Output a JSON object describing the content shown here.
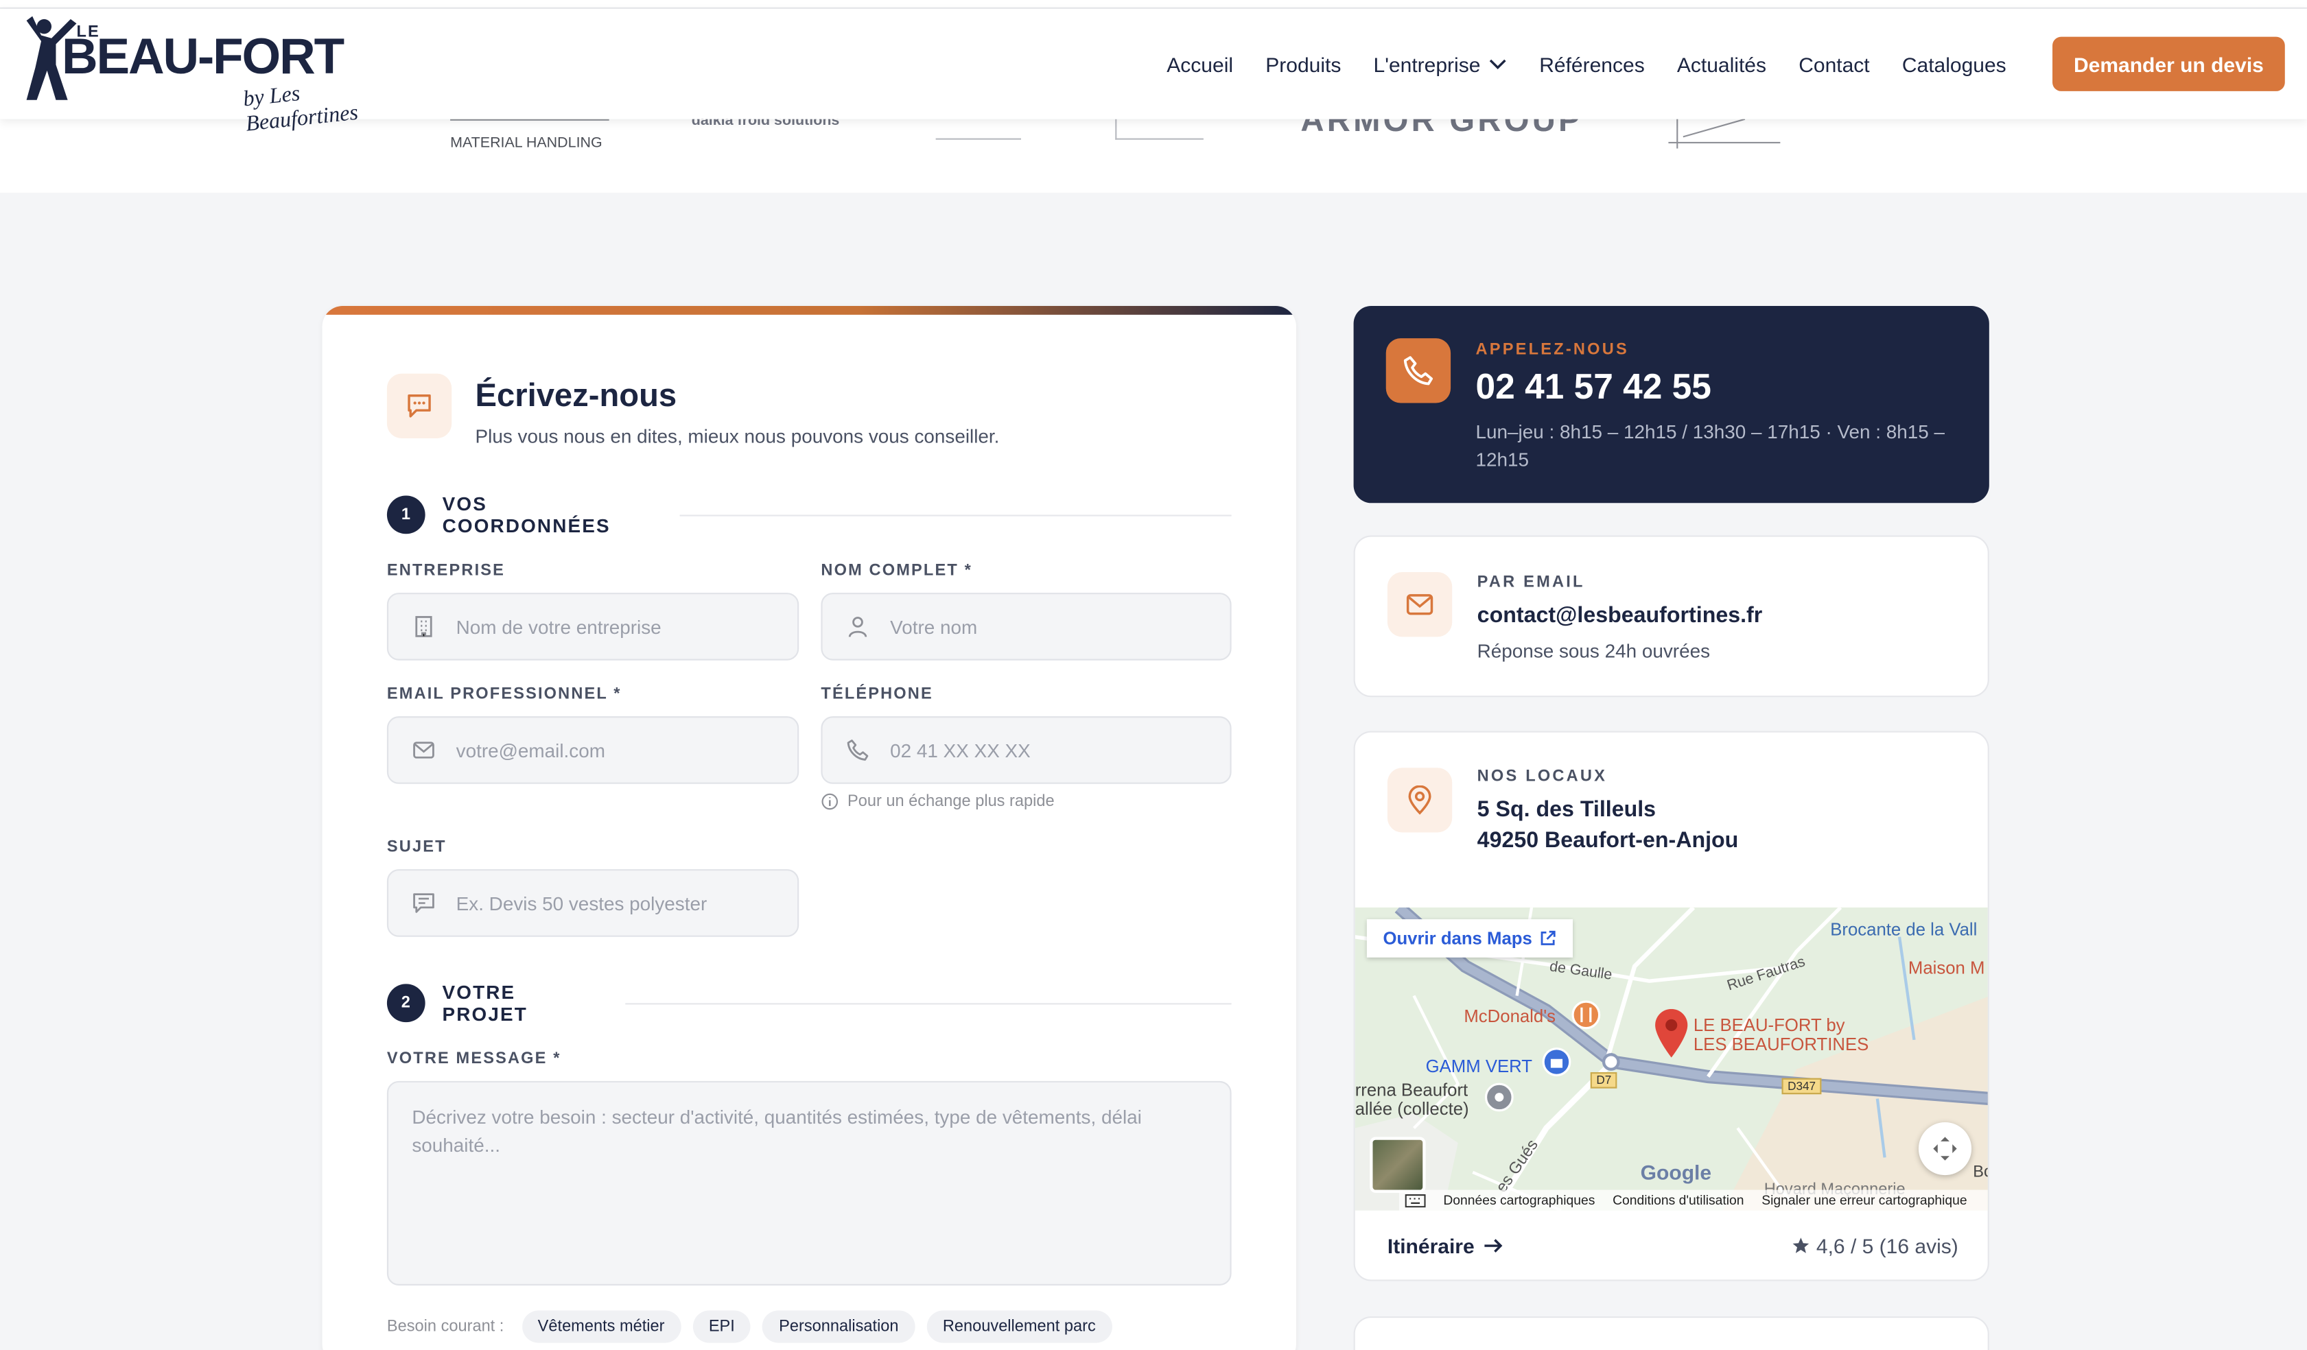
{
  "header": {
    "brand_small": "LE",
    "brand": "BEAU-FORT",
    "byline": "by Les Beaufortines",
    "nav": [
      "Accueil",
      "Produits",
      "L'entreprise",
      "Références",
      "Actualités",
      "Contact",
      "Catalogues"
    ],
    "cta": "Demander un devis"
  },
  "logos_strip": {
    "material": "MATERIAL HANDLING",
    "dalkia": "dalkia froid solutions",
    "armor": "ARMOR GROUP"
  },
  "form": {
    "title": "Écrivez-nous",
    "subtitle": "Plus vous nous en dites, mieux nous pouvons vous conseiller.",
    "step1": {
      "num": "1",
      "label": "VOS COORDONNÉES"
    },
    "step2": {
      "num": "2",
      "label": "VOTRE PROJET"
    },
    "company_label": "ENTREPRISE",
    "company_placeholder": "Nom de votre entreprise",
    "name_label": "NOM COMPLET *",
    "name_placeholder": "Votre nom",
    "email_label": "EMAIL PROFESSIONNEL *",
    "email_placeholder": "votre@email.com",
    "phone_label": "TÉLÉPHONE",
    "phone_placeholder": "02 41 XX XX XX",
    "phone_hint": "Pour un échange plus rapide",
    "subject_label": "SUJET",
    "subject_placeholder": "Ex. Devis 50 vestes polyester",
    "message_label": "VOTRE MESSAGE *",
    "message_placeholder": "Décrivez votre besoin : secteur d'activité, quantités estimées, type de vêtements, délai souhaité...",
    "chips_label": "Besoin courant :",
    "chips": [
      "Vêtements métier",
      "EPI",
      "Personnalisation",
      "Renouvellement parc"
    ]
  },
  "call": {
    "kicker": "APPELEZ-NOUS",
    "phone": "02 41 57 42 55",
    "hours": "Lun–jeu : 8h15 – 12h15 / 13h30 – 17h15 · Ven : 8h15 – 12h15"
  },
  "email_box": {
    "kicker": "PAR EMAIL",
    "email": "contact@lesbeaufortines.fr",
    "note": "Réponse sous 24h ouvrées"
  },
  "location": {
    "kicker": "NOS LOCAUX",
    "line1": "5 Sq. des Tilleuls",
    "line2": "49250 Beaufort-en-Anjou"
  },
  "map": {
    "open_label": "Ouvrir dans Maps",
    "places": {
      "brocante": "Brocante de la Vall",
      "maison": "Maison M",
      "gaulle": "de Gaulle",
      "fautras": "Rue Fautras",
      "mcdo": "McDonald's",
      "marker": "LE BEAU-FORT by",
      "marker2": "LES BEAUFORTINES",
      "gamm": "GAMM VERT",
      "arena1": "rrena Beaufort",
      "arena2": "allée (collecte)",
      "d7": "D7",
      "d347": "D347",
      "gues": "es Gués",
      "google": "Google",
      "howard": "Hovard Maçonnerie",
      "b": "Bc"
    },
    "footer_links": [
      "Données cartographiques",
      "Conditions d'utilisation",
      "Signaler une erreur cartographique"
    ],
    "route": "Itinéraire",
    "rating": "4,6 / 5 (16 avis)"
  },
  "colors": {
    "navy": "#1c2541",
    "accent": "#d8773c",
    "bg": "#f4f5f7"
  }
}
